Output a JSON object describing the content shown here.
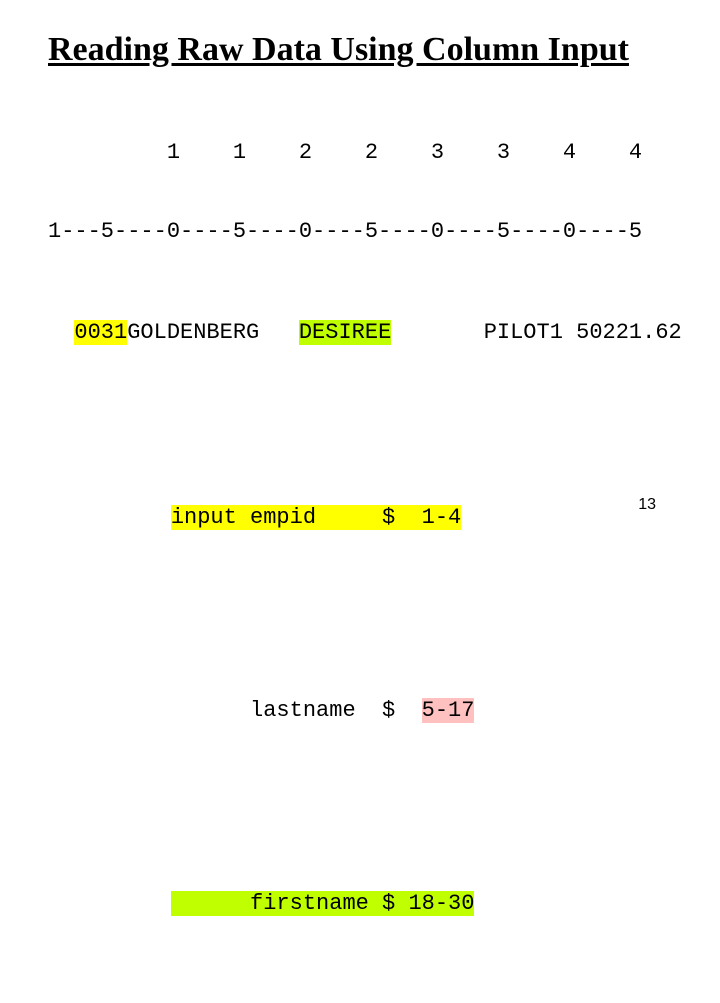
{
  "title": "Reading Raw Data Using Column Input",
  "ruler": {
    "tens": "         1    1    2    2    3    3    4    4",
    "units": "1---5----0----5----0----5----0----5----0----5"
  },
  "data": {
    "seg1": "0031",
    "seg2": "GOLDENBERG   ",
    "seg2_gap": "",
    "seg3": "DESIREE",
    "gap4": "       ",
    "seg4": "PILOT1 50221.62"
  },
  "input": {
    "row1": "input empid     $  1-4",
    "row2_label": "      lastname  $  ",
    "row2_range": "5-17",
    "row3": "      firstname $ 18-30"
  },
  "page_number": "13"
}
